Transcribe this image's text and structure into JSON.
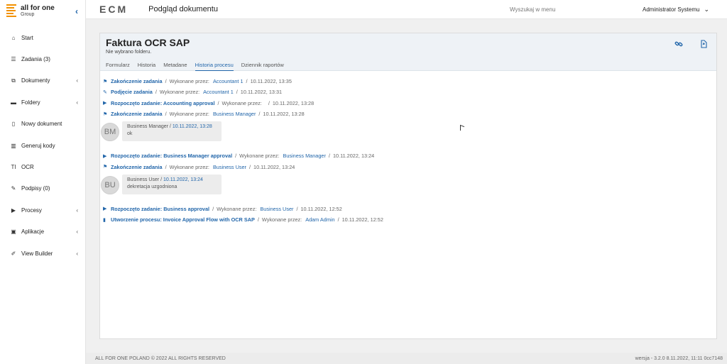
{
  "logo": {
    "title": "all for one",
    "subtitle": "Group"
  },
  "topbar": {
    "brand": "ECM",
    "page_title": "Podgląd dokumentu",
    "menu_search": "Wyszukaj w menu",
    "user_name": "Administrator Systemu"
  },
  "sidebar": {
    "items": [
      {
        "label": "Start",
        "icon": "home-icon",
        "glyph": "⌂",
        "chevron": false
      },
      {
        "label": "Zadania (3)",
        "icon": "list-icon",
        "glyph": "☰",
        "chevron": false
      },
      {
        "label": "Dokumenty",
        "icon": "copy-icon",
        "glyph": "⧉",
        "chevron": true
      },
      {
        "label": "Foldery",
        "icon": "folder-icon",
        "glyph": "▬",
        "chevron": true
      },
      {
        "label": "Nowy dokument",
        "icon": "file-icon",
        "glyph": "▯",
        "chevron": false
      },
      {
        "label": "Generuj kody",
        "icon": "barcode-icon",
        "glyph": "▥",
        "chevron": false
      },
      {
        "label": "OCR",
        "icon": "text-icon",
        "glyph": "TI",
        "chevron": false
      },
      {
        "label": "Podpisy (0)",
        "icon": "pen-icon",
        "glyph": "✎",
        "chevron": false
      },
      {
        "label": "Procesy",
        "icon": "play-icon",
        "glyph": "▶",
        "chevron": true
      },
      {
        "label": "Aplikacje",
        "icon": "app-icon",
        "glyph": "▣",
        "chevron": true
      },
      {
        "label": "View Builder",
        "icon": "wrench-icon",
        "glyph": "✐",
        "chevron": true
      }
    ]
  },
  "document": {
    "title": "Faktura OCR SAP",
    "subtitle": "Nie wybrano folderu.",
    "tabs": [
      "Formularz",
      "Historia",
      "Metadane",
      "Historia procesu",
      "Dziennik raportów"
    ],
    "active_tab": 3
  },
  "history": {
    "performed_by_label": "Wykonane przez:",
    "events": [
      {
        "type": "event",
        "icon": "flag-icon",
        "glyph": "⚑",
        "name": "Zakończenie zadania",
        "who": "Accountant 1",
        "date": "10.11.2022, 13:35"
      },
      {
        "type": "event",
        "icon": "edit-icon",
        "glyph": "✎",
        "name": "Podjęcie zadania",
        "who": "Accountant 1",
        "date": "10.11.2022, 13:31"
      },
      {
        "type": "event",
        "icon": "play-icon",
        "glyph": "▶",
        "name": "Rozpoczęto zadanie: Accounting approval",
        "who": "",
        "date": "10.11.2022, 13:28"
      },
      {
        "type": "event",
        "icon": "flag-icon",
        "glyph": "⚑",
        "name": "Zakończenie zadania",
        "who": "Business Manager",
        "date": "10.11.2022, 13:28"
      },
      {
        "type": "comment",
        "initials": "BM",
        "author": "Business Manager",
        "date": "10.11.2022, 13:28",
        "text": "ok"
      },
      {
        "type": "event",
        "icon": "play-icon",
        "glyph": "▶",
        "name": "Rozpoczęto zadanie: Business Manager approval",
        "who": "Business Manager",
        "date": "10.11.2022, 13:24"
      },
      {
        "type": "event",
        "icon": "flag-icon",
        "glyph": "⚑",
        "name": "Zakończenie zadania",
        "who": "Business User",
        "date": "10.11.2022, 13:24"
      },
      {
        "type": "comment",
        "initials": "BU",
        "author": "Business User",
        "date": "10.11.2022, 13:24",
        "text": "dekretacja uzgodniona"
      },
      {
        "type": "event",
        "icon": "play-icon",
        "glyph": "▶",
        "name": "Rozpoczęto zadanie: Business approval",
        "who": "Business User",
        "date": "10.11.2022, 12:52"
      },
      {
        "type": "event",
        "icon": "file-icon",
        "glyph": "▮",
        "name": "Utworzenie procesu: Invoice Approval Flow with OCR SAP",
        "who": "Adam Admin",
        "date": "10.11.2022, 12:52"
      }
    ]
  },
  "footer": {
    "copyright": "ALL FOR ONE POLAND © 2022 ALL RIGHTS RESERVED",
    "version": "wersja - 3.2.0 8.11.2022, 11:11 0cc7148"
  },
  "colors": {
    "accent": "#2266aa",
    "brand_orange": "#f29100"
  }
}
